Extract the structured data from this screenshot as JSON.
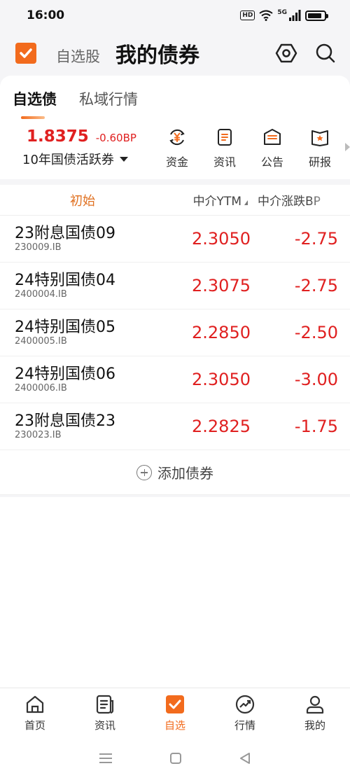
{
  "status": {
    "time": "16:00",
    "hd": "HD",
    "network": "5G",
    "battery_level": 0.85
  },
  "header": {
    "subtitle": "自选股",
    "title": "我的债券"
  },
  "tabs": [
    {
      "label": "自选债",
      "active": true
    },
    {
      "label": "私域行情",
      "active": false
    }
  ],
  "benchmark": {
    "yield": "1.8375",
    "change": "-0.60BP",
    "name": "10年国债活跃券"
  },
  "quick_links": [
    {
      "label": "资金",
      "icon": "yen-exchange-icon"
    },
    {
      "label": "资讯",
      "icon": "document-icon"
    },
    {
      "label": "公告",
      "icon": "announcement-icon"
    },
    {
      "label": "研报",
      "icon": "research-report-icon"
    }
  ],
  "list_header": {
    "sort_label": "初始",
    "ytm_label": "中介YTM",
    "chg_label": "中介涨跌BP"
  },
  "bonds": [
    {
      "name": "23附息国债09",
      "code": "230009.IB",
      "ytm": "2.3050",
      "chg": "-2.75"
    },
    {
      "name": "24特别国债04",
      "code": "2400004.IB",
      "ytm": "2.3075",
      "chg": "-2.75"
    },
    {
      "name": "24特别国债05",
      "code": "2400005.IB",
      "ytm": "2.2850",
      "chg": "-2.50"
    },
    {
      "name": "24特别国债06",
      "code": "2400006.IB",
      "ytm": "2.3050",
      "chg": "-3.00"
    },
    {
      "name": "23附息国债23",
      "code": "230023.IB",
      "ytm": "2.2825",
      "chg": "-1.75"
    }
  ],
  "add_bond_label": "添加债券",
  "bottom_nav": [
    {
      "label": "首页",
      "icon": "home-icon"
    },
    {
      "label": "资讯",
      "icon": "news-icon"
    },
    {
      "label": "自选",
      "icon": "watchlist-icon",
      "active": true
    },
    {
      "label": "行情",
      "icon": "market-icon"
    },
    {
      "label": "我的",
      "icon": "profile-icon"
    }
  ],
  "colors": {
    "accent": "#f26b1d",
    "down": "#e02020"
  }
}
